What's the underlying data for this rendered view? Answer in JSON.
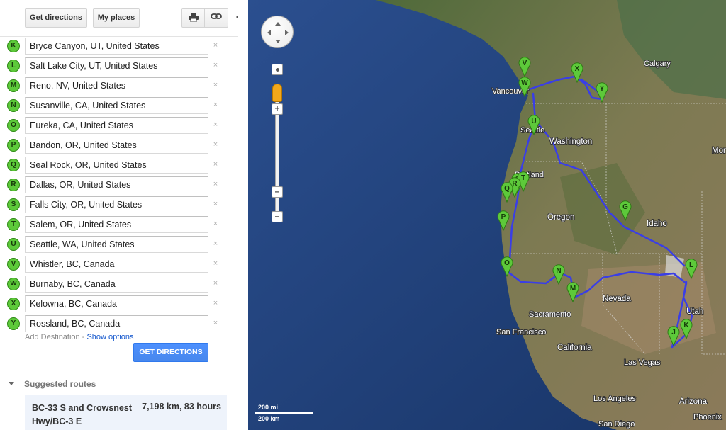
{
  "toolbar": {
    "get_directions_label": "Get directions",
    "my_places_label": "My places",
    "print_icon": "printer-icon",
    "link_icon": "link-icon"
  },
  "destinations": [
    {
      "letter": "K",
      "value": "Bryce Canyon, UT, United States"
    },
    {
      "letter": "L",
      "value": "Salt Lake City, UT, United States"
    },
    {
      "letter": "M",
      "value": "Reno, NV, United States"
    },
    {
      "letter": "N",
      "value": "Susanville, CA, United States"
    },
    {
      "letter": "O",
      "value": "Eureka, CA, United States"
    },
    {
      "letter": "P",
      "value": "Bandon, OR, United States"
    },
    {
      "letter": "Q",
      "value": "Seal Rock, OR, United States"
    },
    {
      "letter": "R",
      "value": "Dallas, OR, United States"
    },
    {
      "letter": "S",
      "value": "Falls City, OR, United States"
    },
    {
      "letter": "T",
      "value": "Salem, OR, United States"
    },
    {
      "letter": "U",
      "value": "Seattle, WA, United States"
    },
    {
      "letter": "V",
      "value": "Whistler, BC, Canada"
    },
    {
      "letter": "W",
      "value": "Burnaby, BC, Canada"
    },
    {
      "letter": "X",
      "value": "Kelowna, BC, Canada"
    },
    {
      "letter": "Y",
      "value": "Rossland, BC, Canada"
    }
  ],
  "remove_glyph": "×",
  "add_destination_label": "Add Destination",
  "separator": " - ",
  "show_options_label": "Show options",
  "get_directions_button_label": "GET DIRECTIONS",
  "suggested_routes_label": "Suggested routes",
  "route": {
    "name": "BC-33 S and Crowsnest Hwy/BC-3 E",
    "distance_time": "7,198 km, 83 hours"
  },
  "map": {
    "labels": [
      "Calgary",
      "Vancouver",
      "Seattle",
      "Washington",
      "Portland",
      "Oregon",
      "Idaho",
      "Mont",
      "Nevada",
      "Utah",
      "Sacramento",
      "San Francisco",
      "California",
      "Las Vegas",
      "Los Angeles",
      "Arizona",
      "Phoenix",
      "San Diego"
    ],
    "scale_mi": "200 mi",
    "scale_km": "200 km",
    "route_color": "#3a3ee6",
    "marker_color": "#5dc93a",
    "ocean_color": "#1f3f78",
    "land_color": "#6d7548"
  }
}
